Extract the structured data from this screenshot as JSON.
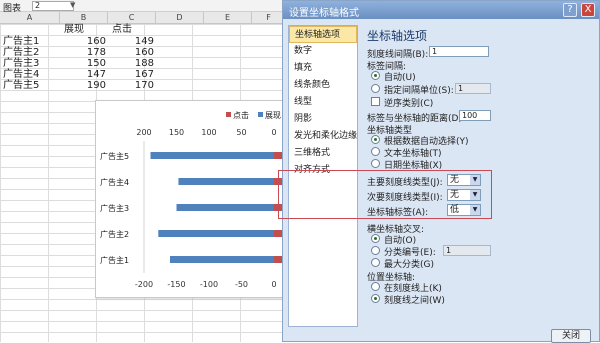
{
  "sheet": {
    "name_label": "图表",
    "name_value": "2",
    "columns": [
      "A",
      "B",
      "C",
      "D",
      "E",
      "F"
    ],
    "headers": {
      "b": "展现",
      "c": "点击"
    },
    "rows": [
      {
        "name": "广告主1",
        "b": "160",
        "c": "149"
      },
      {
        "name": "广告主2",
        "b": "178",
        "c": "160"
      },
      {
        "name": "广告主3",
        "b": "150",
        "c": "188"
      },
      {
        "name": "广告主4",
        "b": "147",
        "c": "167"
      },
      {
        "name": "广告主5",
        "b": "190",
        "c": "170"
      }
    ]
  },
  "chart_data": {
    "type": "bar",
    "orientation": "horizontal",
    "categories": [
      "广告主1",
      "广告主2",
      "广告主3",
      "广告主4",
      "广告主5"
    ],
    "series": [
      {
        "name": "展现",
        "values": [
          -160,
          -178,
          -150,
          -147,
          -190
        ],
        "color": "#4f81bd"
      },
      {
        "name": "点击",
        "values": [
          149,
          160,
          188,
          167,
          170
        ],
        "color": "#c0504d"
      }
    ],
    "top_tick_labels": [
      "200",
      "150",
      "100",
      "50",
      "0"
    ],
    "bottom_tick_labels": [
      "-200",
      "-150",
      "-100",
      "-50",
      "0"
    ],
    "xlim": [
      -200,
      200
    ],
    "legend": {
      "position": "top-right"
    }
  },
  "dialog": {
    "title": "设置坐标轴格式",
    "help": "?",
    "close_x": "X",
    "nav": [
      "坐标轴选项",
      "数字",
      "填充",
      "线条颜色",
      "线型",
      "阴影",
      "发光和柔化边缘",
      "三维格式",
      "对齐方式"
    ],
    "section_title": "坐标轴选项",
    "tick_interval_label": "刻度线间隔(B):",
    "tick_interval_value": "1",
    "label_interval_label": "标签间隔:",
    "auto_label": "自动(U)",
    "specify_label": "指定间隔单位(S):",
    "specify_value": "1",
    "reverse_label": "逆序类别(C)",
    "label_distance_label": "标签与坐标轴的距离(D):",
    "label_distance_value": "100",
    "axis_type_label": "坐标轴类型",
    "axis_type_opts": [
      "根据数据自动选择(Y)",
      "文本坐标轴(T)",
      "日期坐标轴(X)"
    ],
    "major_tick_label": "主要刻度线类型(J):",
    "major_tick_value": "无",
    "minor_tick_label": "次要刻度线类型(I):",
    "minor_tick_value": "无",
    "axis_label_label": "坐标轴标签(A):",
    "axis_label_value": "低",
    "cross_label": "横坐标轴交叉:",
    "cross_opts": [
      "自动(O)",
      "分类编号(E):",
      "最大分类(G)"
    ],
    "cross_value": "1",
    "position_label": "位置坐标轴:",
    "position_opts": [
      "在刻度线上(K)",
      "刻度线之间(W)"
    ],
    "close_button": "关闭"
  }
}
